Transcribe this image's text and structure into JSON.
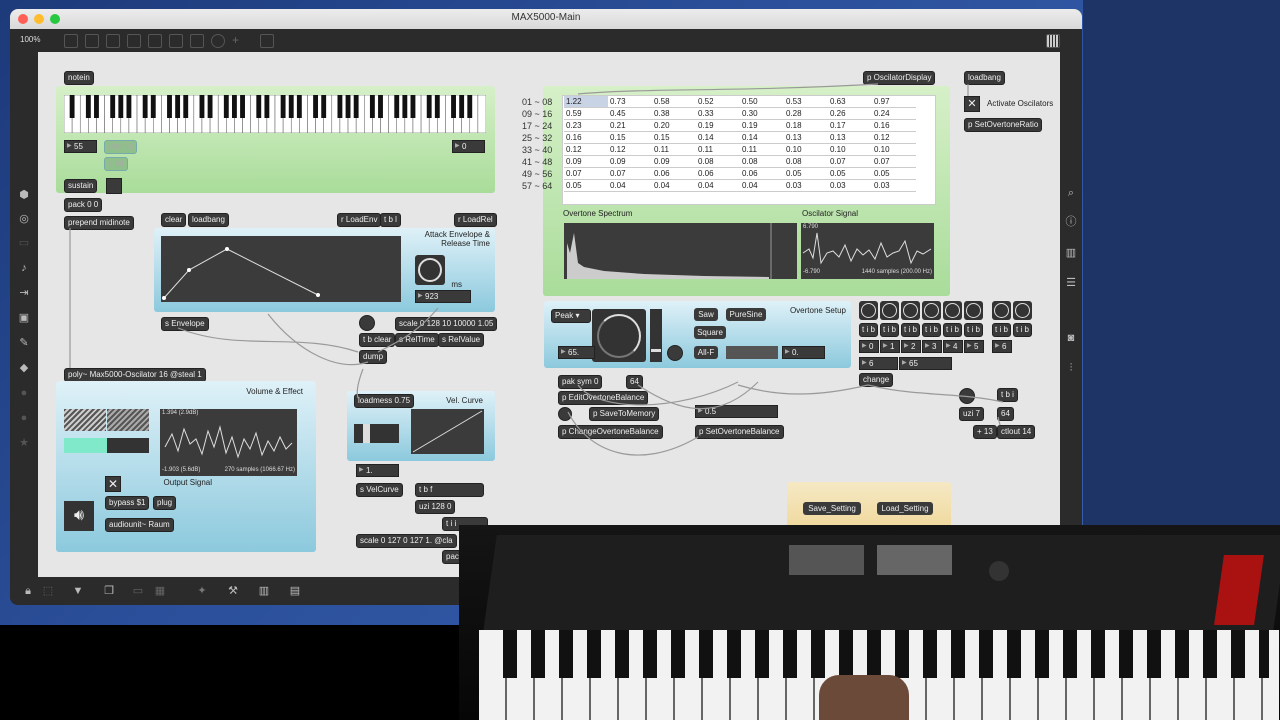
{
  "window": {
    "title": "MAX5000-Main",
    "zoom": "100%"
  },
  "keyboard_section": {
    "notein": "notein",
    "num_left": "55",
    "ctlin": "ctlin 64",
    "gt64": "> 64",
    "num_right": "0",
    "sustain": "sustain",
    "pack": "pack 0 0",
    "prepend": "prepend midinote"
  },
  "envelope": {
    "clear": "clear",
    "loadbang": "loadbang",
    "r_loadenv": "r LoadEnv",
    "tbl": "t b l",
    "r_loadrel": "r LoadRel",
    "title": "Attack Envelope & Release Time",
    "ms": "ms",
    "release_value": "923",
    "s_envelope": "s Envelope",
    "scale": "scale 0 128 10 10000 1.05",
    "tb_clear": "t b clear",
    "s_reltime": "s RelTime",
    "s_relvalue": "s RelValue",
    "dump": "dump"
  },
  "volume": {
    "poly": "poly~ Max5000-Oscilator 16 @steal 1",
    "title": "Volume & Effect",
    "scope_top": "1.394 (2.9dB)",
    "scope_bottom": "-1.903 (5.6dB)",
    "scope_samples": "270 samples (1066.67 Hz)",
    "output_signal": "Output Signal",
    "bypass": "bypass $1",
    "plug": "plug",
    "audiounit": "audiounit~ Raum"
  },
  "velcurve": {
    "loadmess": "loadmess 0.75",
    "title": "Vel. Curve",
    "num": "1.",
    "s_velcurve": "s VelCurve",
    "tbf": "t b f",
    "uzi": "uzi 128 0",
    "tii": "t i i",
    "scale": "scale 0 127 0 127 1. @cla",
    "pac": "pac"
  },
  "overtone_table": {
    "row_labels": [
      "01 ~ 08",
      "09 ~ 16",
      "17 ~ 24",
      "25 ~ 32",
      "33 ~ 40",
      "41 ~ 48",
      "49 ~ 56",
      "57 ~ 64"
    ],
    "rows": [
      [
        "1.22",
        "0.73",
        "0.58",
        "0.52",
        "0.50",
        "0.53",
        "0.63",
        "0.97"
      ],
      [
        "0.59",
        "0.45",
        "0.38",
        "0.33",
        "0.30",
        "0.28",
        "0.26",
        "0.24"
      ],
      [
        "0.23",
        "0.21",
        "0.20",
        "0.19",
        "0.19",
        "0.18",
        "0.17",
        "0.16"
      ],
      [
        "0.16",
        "0.15",
        "0.15",
        "0.14",
        "0.14",
        "0.13",
        "0.13",
        "0.12"
      ],
      [
        "0.12",
        "0.12",
        "0.11",
        "0.11",
        "0.11",
        "0.10",
        "0.10",
        "0.10"
      ],
      [
        "0.09",
        "0.09",
        "0.09",
        "0.08",
        "0.08",
        "0.08",
        "0.07",
        "0.07"
      ],
      [
        "0.07",
        "0.07",
        "0.06",
        "0.06",
        "0.06",
        "0.05",
        "0.05",
        "0.05"
      ],
      [
        "0.05",
        "0.04",
        "0.04",
        "0.04",
        "0.04",
        "0.03",
        "0.03",
        "0.03"
      ]
    ],
    "spectrum_label": "Overtone Spectrum",
    "osc_label": "Oscilator Signal",
    "osc_top": "6.790",
    "osc_bottom": "-6.790",
    "osc_samples": "1440 samples (200.00 Hz)"
  },
  "top_right": {
    "p_display": "p OscilatorDisplay",
    "loadbang": "loadbang",
    "activate": "Activate Oscilators",
    "p_ratio": "p SetOvertoneRatio"
  },
  "overtone_setup": {
    "title": "Overtone Setup",
    "peak": "Peak",
    "saw": "Saw",
    "puresine": "PureSine",
    "square": "Square",
    "allf": "All-F",
    "num_left": "65.",
    "num_right": "0.",
    "pak": "pak sym 0",
    "n64": "64",
    "p_edit": "p EditOvertoneBalance",
    "p_save": "p SaveToMemory",
    "p_change": "p ChangeOvertoneBalance",
    "val": "0.5",
    "p_set": "p SetOvertoneBalance",
    "tib": "t i b",
    "digits": [
      "0",
      "1",
      "2",
      "3",
      "4",
      "5",
      "6"
    ],
    "n6": "6",
    "n65": "65",
    "change": "change",
    "uzi7": "uzi 7",
    "tbi": "t b i",
    "n64b": "64",
    "plus13": "+ 13",
    "ctlout": "ctlout 14"
  },
  "settings": {
    "save": "Save_Setting",
    "load": "Load_Setting"
  }
}
